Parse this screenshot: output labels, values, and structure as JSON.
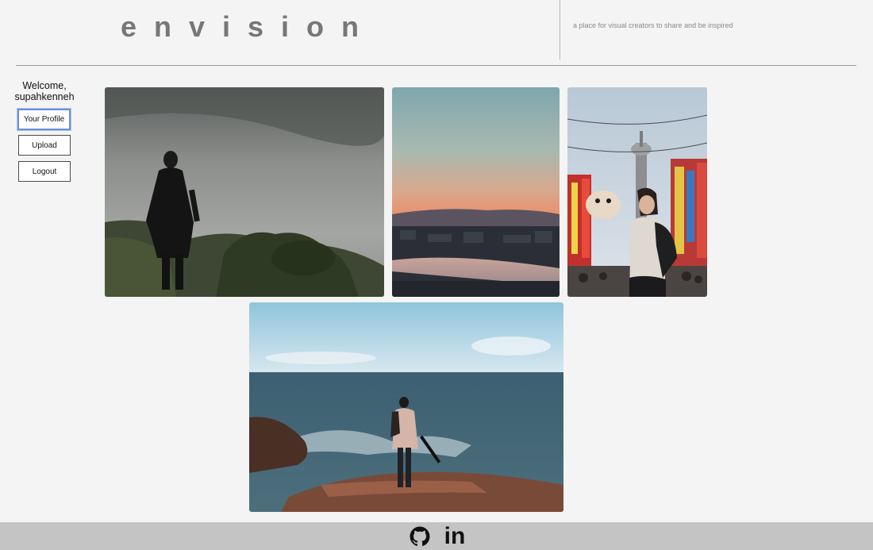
{
  "header": {
    "brand": "envision",
    "tagline": "a place for visual creators to share and be inspired"
  },
  "sidebar": {
    "welcome_line1": "Welcome,",
    "username": "supahkenneh",
    "buttons": {
      "profile": "Your Profile",
      "upload": "Upload",
      "logout": "Logout"
    }
  },
  "gallery": {
    "photos": [
      {
        "subject": "man in dark coat standing on a foggy hillside"
      },
      {
        "subject": "sunset over a city and river"
      },
      {
        "subject": "woman with backpack on a neon-signed street with tower"
      },
      {
        "subject": "person with camera standing on rocks facing the ocean"
      }
    ]
  },
  "footer": {
    "icons": [
      "github-icon",
      "linkedin-icon"
    ],
    "linkedin_text": "in"
  },
  "colors": {
    "background": "#f4f4f4",
    "brand_text": "#777777",
    "footer_bg": "#c4c4c4",
    "focus_ring": "#6b8fd8"
  }
}
